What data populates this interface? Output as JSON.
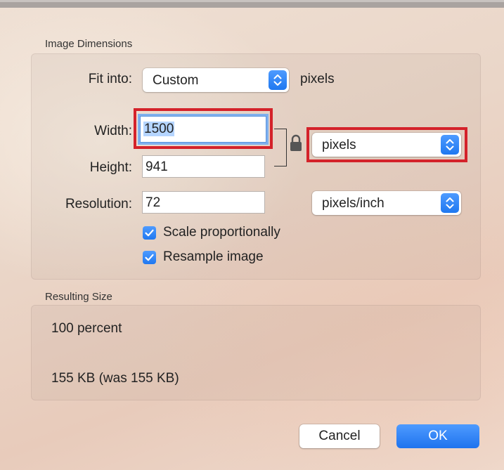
{
  "image_dimensions": {
    "title": "Image Dimensions",
    "fit_into": {
      "label": "Fit into:",
      "value": "Custom",
      "unit_text": "pixels"
    },
    "width": {
      "label": "Width:",
      "value": "1500"
    },
    "height": {
      "label": "Height:",
      "value": "941"
    },
    "size_unit": {
      "value": "pixels"
    },
    "resolution": {
      "label": "Resolution:",
      "value": "72",
      "unit": "pixels/inch"
    },
    "scale_proportionally": {
      "label": "Scale proportionally",
      "checked": true
    },
    "resample_image": {
      "label": "Resample image",
      "checked": true
    }
  },
  "resulting_size": {
    "title": "Resulting Size",
    "percent": "100 percent",
    "file_size": "155 KB (was 155 KB)"
  },
  "buttons": {
    "cancel": "Cancel",
    "ok": "OK"
  },
  "icons": {
    "lock": "lock-icon",
    "stepper": "chevron-up-down-icon",
    "checkmark": "checkmark-icon"
  },
  "colors": {
    "accent": "#1f78f0",
    "highlight_box": "#d4222a",
    "selection": "#b5d5ff"
  }
}
